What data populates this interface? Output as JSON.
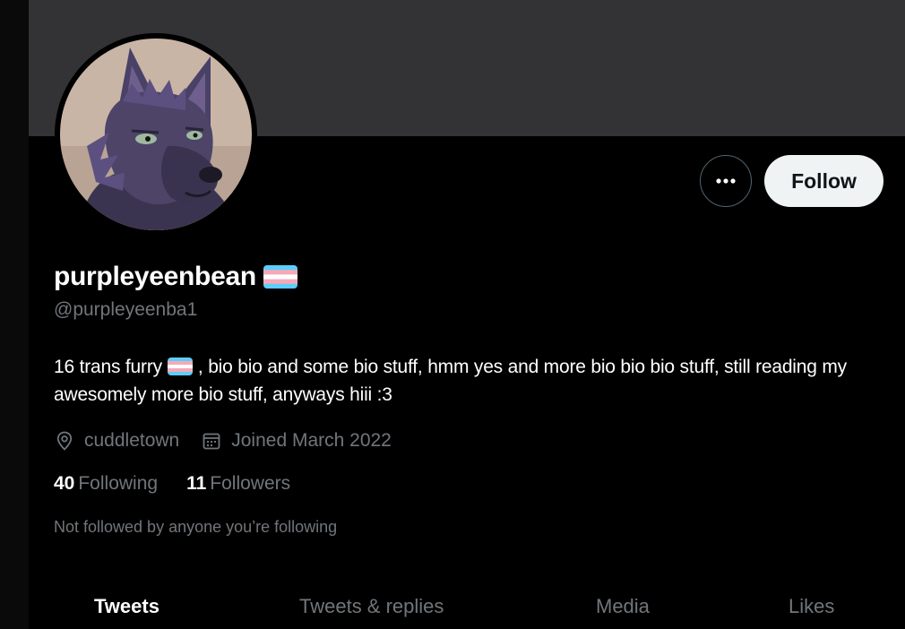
{
  "profile": {
    "display_name": "purpleyeenbean",
    "handle": "@purpleyeenba1",
    "bio_part1": "16  trans furry",
    "bio_part2": ", bio bio and some bio stuff, hmm yes and more bio bio bio stuff, still reading my awesomely more bio stuff, anyways hiii :3",
    "location": "cuddletown",
    "joined": "Joined March 2022",
    "following_count": "40",
    "following_label": "Following",
    "followers_count": "11",
    "followers_label": "Followers",
    "not_followed_text": "Not followed by anyone you’re following"
  },
  "actions": {
    "follow_label": "Follow",
    "more_icon": "more-options-icon"
  },
  "tabs": [
    {
      "label": "Tweets",
      "active": true
    },
    {
      "label": "Tweets & replies",
      "active": false
    },
    {
      "label": "Media",
      "active": false
    },
    {
      "label": "Likes",
      "active": false
    }
  ],
  "colors": {
    "background": "#000000",
    "banner": "#333336",
    "follow_button_bg": "#eff3f4",
    "secondary_text": "#71767b",
    "trans_flag_blue": "#5bcefa",
    "trans_flag_pink": "#f5a9b8",
    "trans_flag_white": "#ffffff"
  }
}
